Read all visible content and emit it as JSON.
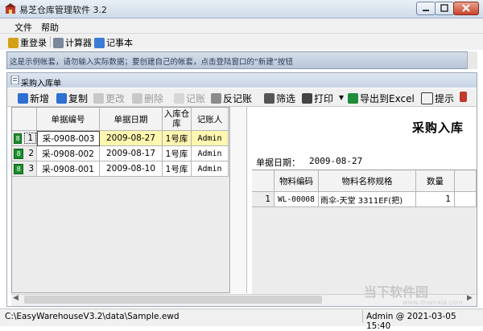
{
  "window": {
    "title": "易芝仓库管理软件 3.2"
  },
  "menu": {
    "items": [
      "文件",
      "帮助"
    ]
  },
  "toolbar1": {
    "relogin": "重登录",
    "calculator": "计算器",
    "notepad": "记事本"
  },
  "notice": {
    "text": "这是示例帐套，请勿输入实际数据；要创建自己的帐套，点击登陆窗口的“新建”按钮"
  },
  "child_window": {
    "title": "采购入库单"
  },
  "toolbar2": {
    "new": "新增",
    "copy": "复制",
    "edit": "更改",
    "delete": "删除",
    "post": "记账",
    "unpost": "反记账",
    "filter": "筛选",
    "print": "打印",
    "export": "导出到Excel",
    "tips": "提示"
  },
  "left_grid": {
    "headers": {
      "doc_no": "单据编号",
      "doc_date": "单据日期",
      "warehouse": "入库仓库",
      "recorder": "记账人"
    },
    "rows": [
      {
        "badge": "8",
        "idx": "1",
        "doc_no": "采-0908-003",
        "doc_date": "2009-08-27",
        "warehouse": "1号库",
        "recorder": "Admin"
      },
      {
        "badge": "8",
        "idx": "2",
        "doc_no": "采-0908-002",
        "doc_date": "2009-08-17",
        "warehouse": "1号库",
        "recorder": "Admin"
      },
      {
        "badge": "8",
        "idx": "3",
        "doc_no": "采-0908-001",
        "doc_date": "2009-08-10",
        "warehouse": "1号库",
        "recorder": "Admin"
      }
    ]
  },
  "right_pane": {
    "title": "采购入库",
    "date_label": "单据日期：",
    "date_value": "2009-08-27",
    "headers": {
      "item_code": "物料编码",
      "item_name": "物料名称规格",
      "qty": "数量"
    },
    "rows": [
      {
        "idx": "1",
        "item_code": "WL-00008",
        "item_name": "雨伞-天堂 3311EF(把)",
        "qty": "1"
      }
    ]
  },
  "status": {
    "path": "C:\\EasyWarehouseV3.2\\data\\Sample.ewd",
    "user_time": "Admin @ 2021-03-05 15:40"
  },
  "watermark": {
    "text": "当下软件园",
    "sub": "www.downxia.com"
  }
}
